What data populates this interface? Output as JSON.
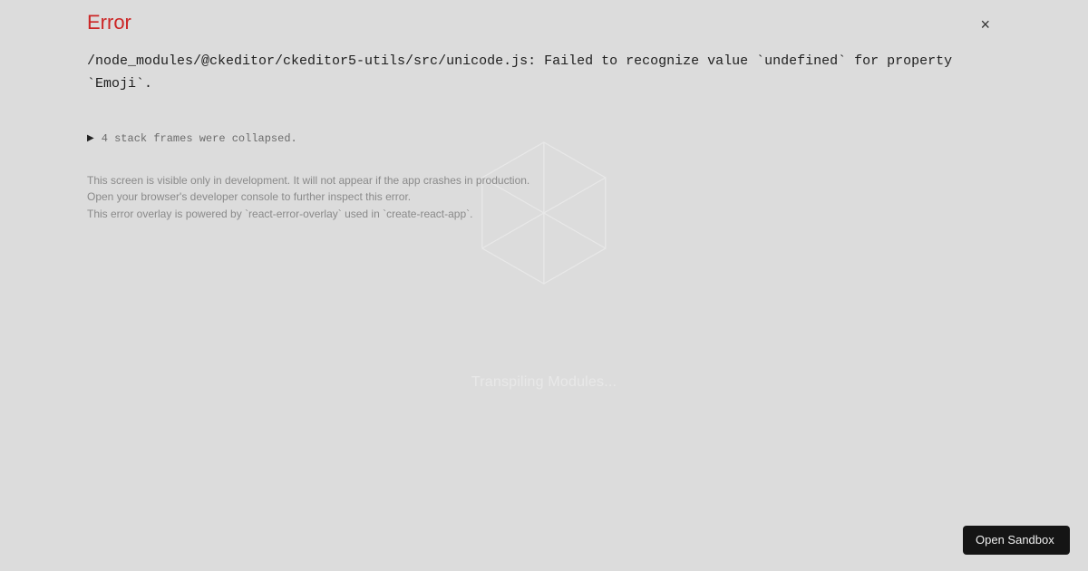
{
  "background": {
    "status_text": "Transpiling Modules..."
  },
  "overlay": {
    "heading": "Error",
    "message": "/node_modules/@ckeditor/ckeditor5-utils/src/unicode.js: Failed to recognize value `undefined` for property `Emoji`.",
    "stack_collapsed": "4 stack frames were collapsed.",
    "footer_line1": "This screen is visible only in development. It will not appear if the app crashes in production.",
    "footer_line2": "Open your browser's developer console to further inspect this error.",
    "footer_line3": "This error overlay is powered by `react-error-overlay` used in `create-react-app`."
  },
  "buttons": {
    "open_sandbox": "Open Sandbox",
    "close": "×"
  }
}
